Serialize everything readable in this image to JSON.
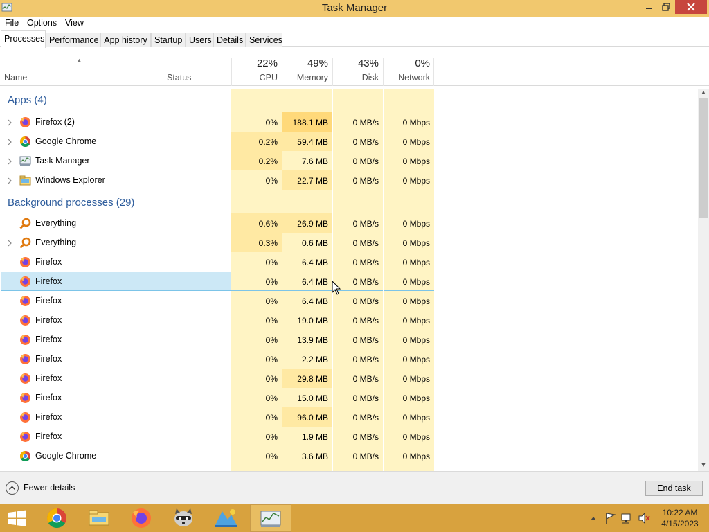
{
  "window": {
    "title": "Task Manager",
    "close_color": "#c7463e",
    "titlebar_color": "#f1c86e"
  },
  "menu": [
    "File",
    "Options",
    "View"
  ],
  "tabs": [
    {
      "label": "Processes",
      "active": true
    },
    {
      "label": "Performance",
      "active": false
    },
    {
      "label": "App history",
      "active": false
    },
    {
      "label": "Startup",
      "active": false
    },
    {
      "label": "Users",
      "active": false
    },
    {
      "label": "Details",
      "active": false
    },
    {
      "label": "Services",
      "active": false
    }
  ],
  "columns": {
    "name": "Name",
    "status": "Status",
    "cpu": {
      "pct": "22%",
      "label": "CPU"
    },
    "memory": {
      "pct": "49%",
      "label": "Memory"
    },
    "disk": {
      "pct": "43%",
      "label": "Disk"
    },
    "network": {
      "pct": "0%",
      "label": "Network"
    }
  },
  "groups": {
    "apps": "Apps (4)",
    "background": "Background processes (29)"
  },
  "apps": [
    {
      "name": "Firefox (2)",
      "icon": "firefox-icon",
      "expandable": true,
      "cpu": "0%",
      "memory": "188.1 MB",
      "disk": "0 MB/s",
      "network": "0 Mbps"
    },
    {
      "name": "Google Chrome",
      "icon": "chrome-icon",
      "expandable": true,
      "cpu": "0.2%",
      "memory": "59.4 MB",
      "disk": "0 MB/s",
      "network": "0 Mbps"
    },
    {
      "name": "Task Manager",
      "icon": "task-manager-icon",
      "expandable": true,
      "cpu": "0.2%",
      "memory": "7.6 MB",
      "disk": "0 MB/s",
      "network": "0 Mbps"
    },
    {
      "name": "Windows Explorer",
      "icon": "explorer-icon",
      "expandable": true,
      "cpu": "0%",
      "memory": "22.7 MB",
      "disk": "0 MB/s",
      "network": "0 Mbps"
    }
  ],
  "background": [
    {
      "name": "Everything",
      "icon": "everything-icon",
      "expandable": false,
      "cpu": "0.6%",
      "memory": "26.9 MB",
      "disk": "0 MB/s",
      "network": "0 Mbps"
    },
    {
      "name": "Everything",
      "icon": "everything-icon",
      "expandable": true,
      "cpu": "0.3%",
      "memory": "0.6 MB",
      "disk": "0 MB/s",
      "network": "0 Mbps"
    },
    {
      "name": "Firefox",
      "icon": "firefox-icon",
      "expandable": false,
      "cpu": "0%",
      "memory": "6.4 MB",
      "disk": "0 MB/s",
      "network": "0 Mbps"
    },
    {
      "name": "Firefox",
      "icon": "firefox-icon",
      "expandable": false,
      "cpu": "0%",
      "memory": "6.4 MB",
      "disk": "0 MB/s",
      "network": "0 Mbps",
      "selected": true
    },
    {
      "name": "Firefox",
      "icon": "firefox-icon",
      "expandable": false,
      "cpu": "0%",
      "memory": "6.4 MB",
      "disk": "0 MB/s",
      "network": "0 Mbps"
    },
    {
      "name": "Firefox",
      "icon": "firefox-icon",
      "expandable": false,
      "cpu": "0%",
      "memory": "19.0 MB",
      "disk": "0 MB/s",
      "network": "0 Mbps"
    },
    {
      "name": "Firefox",
      "icon": "firefox-icon",
      "expandable": false,
      "cpu": "0%",
      "memory": "13.9 MB",
      "disk": "0 MB/s",
      "network": "0 Mbps"
    },
    {
      "name": "Firefox",
      "icon": "firefox-icon",
      "expandable": false,
      "cpu": "0%",
      "memory": "2.2 MB",
      "disk": "0 MB/s",
      "network": "0 Mbps"
    },
    {
      "name": "Firefox",
      "icon": "firefox-icon",
      "expandable": false,
      "cpu": "0%",
      "memory": "29.8 MB",
      "disk": "0 MB/s",
      "network": "0 Mbps"
    },
    {
      "name": "Firefox",
      "icon": "firefox-icon",
      "expandable": false,
      "cpu": "0%",
      "memory": "15.0 MB",
      "disk": "0 MB/s",
      "network": "0 Mbps"
    },
    {
      "name": "Firefox",
      "icon": "firefox-icon",
      "expandable": false,
      "cpu": "0%",
      "memory": "96.0 MB",
      "disk": "0 MB/s",
      "network": "0 Mbps"
    },
    {
      "name": "Firefox",
      "icon": "firefox-icon",
      "expandable": false,
      "cpu": "0%",
      "memory": "1.9 MB",
      "disk": "0 MB/s",
      "network": "0 Mbps"
    },
    {
      "name": "Google Chrome",
      "icon": "chrome-icon",
      "expandable": false,
      "cpu": "0%",
      "memory": "3.6 MB",
      "disk": "0 MB/s",
      "network": "0 Mbps"
    }
  ],
  "heat_colors": {
    "light": "#fff4c4",
    "medium": "#ffe9a3",
    "strong": "#ffd97a"
  },
  "footer": {
    "fewer_details": "Fewer details",
    "end_task": "End task"
  },
  "taskbar": {
    "items": [
      "windows-start-icon",
      "chrome-icon",
      "file-explorer-icon",
      "firefox-icon",
      "raccoon-app-icon",
      "paint-app-icon",
      "task-manager-icon"
    ],
    "time": "10:22 AM",
    "date": "4/15/2023"
  }
}
